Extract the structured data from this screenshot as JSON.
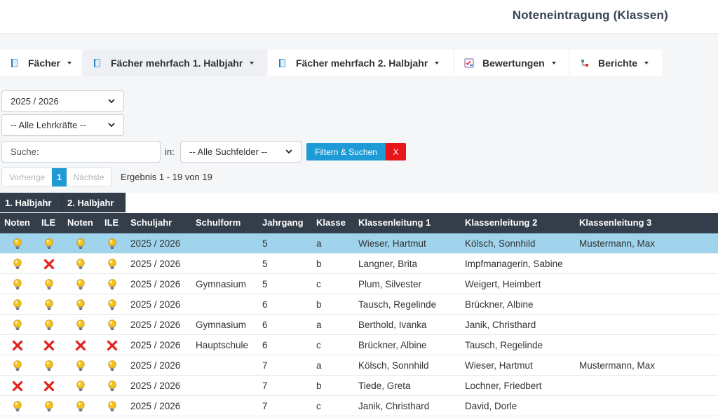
{
  "header": {
    "title": "Noteneintragung (Klassen)"
  },
  "nav": [
    {
      "label": "Fächer",
      "icon": "book-icon"
    },
    {
      "label": "Fächer mehrfach 1. Halbjahr",
      "icon": "book-icon"
    },
    {
      "label": "Fächer mehrfach 2. Halbjahr",
      "icon": "book-icon"
    },
    {
      "label": "Bewertungen",
      "icon": "checklist-icon"
    },
    {
      "label": "Berichte",
      "icon": "chart-icon"
    }
  ],
  "filters": {
    "year": "2025 / 2026",
    "teacher": "-- Alle Lehrkräfte --",
    "search_placeholder": "Suche:",
    "in_label": "in:",
    "fields": "-- Alle Suchfelder --",
    "filter_button": "Filtern & Suchen",
    "clear_button": "X"
  },
  "pager": {
    "prev": "Vorherige",
    "page": "1",
    "next": "Nächste",
    "result": "Ergebnis 1 - 19 von 19"
  },
  "tabs": [
    "1. Halbjahr",
    "2. Halbjahr"
  ],
  "columns": [
    "Noten",
    "ILE",
    "Noten",
    "ILE",
    "Schuljahr",
    "Schulform",
    "Jahrgang",
    "Klasse",
    "Klassenleitung 1",
    "Klassenleitung 2",
    "Klassenleitung 3"
  ],
  "rows": [
    {
      "icons": [
        "bulb",
        "bulb",
        "bulb",
        "bulb"
      ],
      "schuljahr": "2025 / 2026",
      "schulform": "",
      "jahrgang": "5",
      "klasse": "a",
      "kl1": "Wieser, Hartmut",
      "kl2": "Kölsch, Sonnhild",
      "kl3": "Mustermann, Max",
      "selected": true
    },
    {
      "icons": [
        "bulb",
        "cross",
        "bulb",
        "bulb"
      ],
      "schuljahr": "2025 / 2026",
      "schulform": "",
      "jahrgang": "5",
      "klasse": "b",
      "kl1": "Langner, Brita",
      "kl2": "Impfmanagerin, Sabine",
      "kl3": ""
    },
    {
      "icons": [
        "bulb",
        "bulb",
        "bulb",
        "bulb"
      ],
      "schuljahr": "2025 / 2026",
      "schulform": "Gymnasium",
      "jahrgang": "5",
      "klasse": "c",
      "kl1": "Plum, Silvester",
      "kl2": "Weigert, Heimbert",
      "kl3": ""
    },
    {
      "icons": [
        "bulb",
        "bulb",
        "bulb",
        "bulb"
      ],
      "schuljahr": "2025 / 2026",
      "schulform": "",
      "jahrgang": "6",
      "klasse": "b",
      "kl1": "Tausch, Regelinde",
      "kl2": "Brückner, Albine",
      "kl3": ""
    },
    {
      "icons": [
        "bulb",
        "bulb",
        "bulb",
        "bulb"
      ],
      "schuljahr": "2025 / 2026",
      "schulform": "Gymnasium",
      "jahrgang": "6",
      "klasse": "a",
      "kl1": "Berthold, Ivanka",
      "kl2": "Janik, Christhard",
      "kl3": ""
    },
    {
      "icons": [
        "cross",
        "cross",
        "cross",
        "cross"
      ],
      "schuljahr": "2025 / 2026",
      "schulform": "Hauptschule",
      "jahrgang": "6",
      "klasse": "c",
      "kl1": "Brückner, Albine",
      "kl2": "Tausch, Regelinde",
      "kl3": ""
    },
    {
      "icons": [
        "bulb",
        "bulb",
        "bulb",
        "bulb"
      ],
      "schuljahr": "2025 / 2026",
      "schulform": "",
      "jahrgang": "7",
      "klasse": "a",
      "kl1": "Kölsch, Sonnhild",
      "kl2": "Wieser, Hartmut",
      "kl3": "Mustermann, Max"
    },
    {
      "icons": [
        "cross",
        "cross",
        "bulb",
        "bulb"
      ],
      "schuljahr": "2025 / 2026",
      "schulform": "",
      "jahrgang": "7",
      "klasse": "b",
      "kl1": "Tiede, Greta",
      "kl2": "Lochner, Friedbert",
      "kl3": ""
    },
    {
      "icons": [
        "bulb",
        "bulb",
        "bulb",
        "bulb"
      ],
      "schuljahr": "2025 / 2026",
      "schulform": "",
      "jahrgang": "7",
      "klasse": "c",
      "kl1": "Janik, Christhard",
      "kl2": "David, Dorle",
      "kl3": ""
    }
  ],
  "colors": {
    "header_bg": "#343d4a",
    "selected_row": "#9fd4ec",
    "primary": "#1e9ad6",
    "danger": "#e8151b"
  }
}
